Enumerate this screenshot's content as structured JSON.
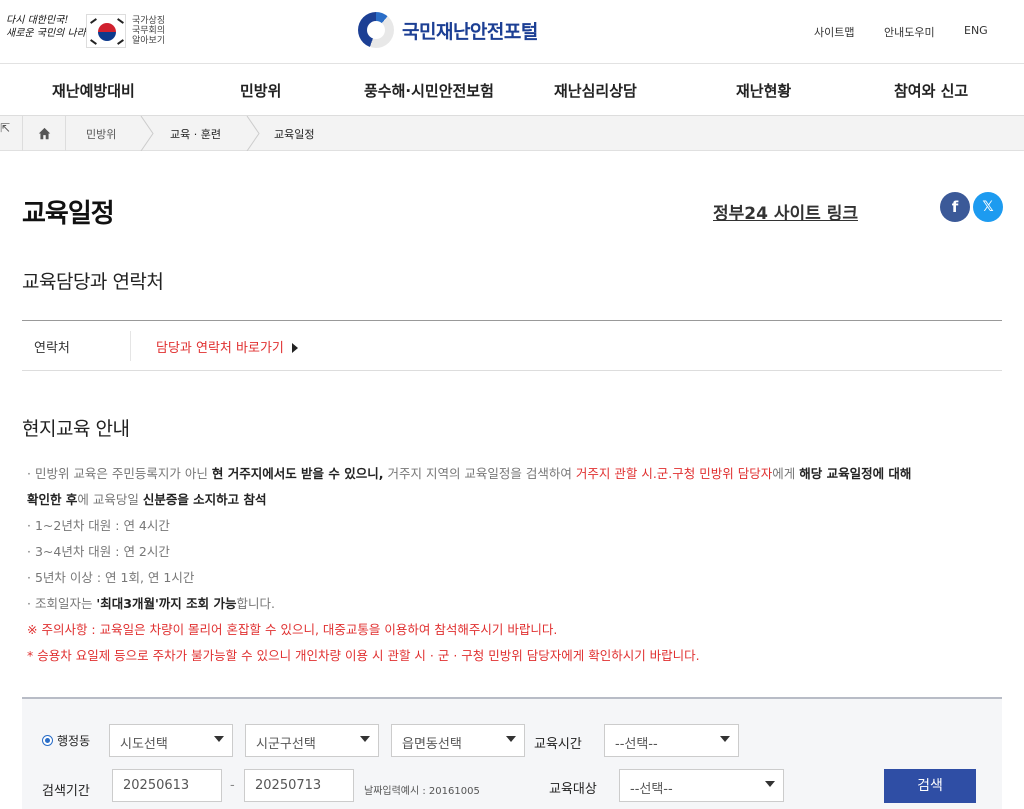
{
  "header": {
    "slogan_line1": "다시 대한민국!",
    "slogan_line2": "새로운 국민의 나라",
    "symbol_text": [
      "국가상징",
      "국무회의",
      "알아보기"
    ],
    "site_name": "국민재난안전포털",
    "util": [
      "사이트맵",
      "안내도우미",
      "ENG"
    ]
  },
  "gnb": [
    "재난예방대비",
    "민방위",
    "풍수해·시민안전보험",
    "재난심리상담",
    "재난현황",
    "참여와 신고"
  ],
  "breadcrumb": [
    "민방위",
    "교육 · 훈련",
    "교육일정"
  ],
  "page": {
    "title": "교육일정",
    "gov_link": "정부24 사이트 링크",
    "sns_facebook": "f",
    "sns_x": "𝕏"
  },
  "contact": {
    "heading": "교육담당과 연락처",
    "label": "연락처",
    "value": "담당과 연락처 바로가기"
  },
  "info": {
    "heading": "현지교육 안내",
    "l1a": "· 민방위 교육은 주민등록지가 아닌 ",
    "l1b": "현 거주지",
    "l1c": "에서도 받을 수 있으니,",
    "l1d": " 거주지 지역의 교육일정을 검색하여 ",
    "l1e": "거주지 관할 시.군.구청 민방위 담당자",
    "l1f": "에게 ",
    "l1g": "해당 교육일정",
    "l1h": "에 대해",
    "l2a": "확인한 후",
    "l2b": "에 교육당일 ",
    "l2c": "신분증을 소지하고 참석",
    "l3": "· 1~2년차 대원 : 연 4시간",
    "l4": "· 3~4년차 대원 : 연 2시간",
    "l5": "· 5년차 이상 : 연 1회, 연 1시간",
    "l6a": "· 조회일자는 ",
    "l6b": "'최대3개월'까지 조회 가능",
    "l6c": "합니다.",
    "l7": "※ 주의사항 : 교육일은 차량이 몰리어 혼잡할 수 있으니, 대중교통을 이용하여 참석해주시기 바랍니다.",
    "l8": "* 승용차 요일제 등으로 주차가 불가능할 수 있으니 개인차량 이용 시 관할 시 · 군 · 구청 민방위 담당자에게 확인하시기 바랍니다."
  },
  "search": {
    "radio_label": "행정동",
    "sido": "시도선택",
    "sigungu": "시군구선택",
    "emd": "읍면동선택",
    "time_label": "교육시간",
    "time_value": "--선택--",
    "period_label": "검색기간",
    "date_from": "20250613",
    "dash": "-",
    "date_to": "20250713",
    "date_hint": "날짜입력예시 : 20161005",
    "target_label": "교육대상",
    "target_value": "--선택--",
    "button": "검색"
  }
}
